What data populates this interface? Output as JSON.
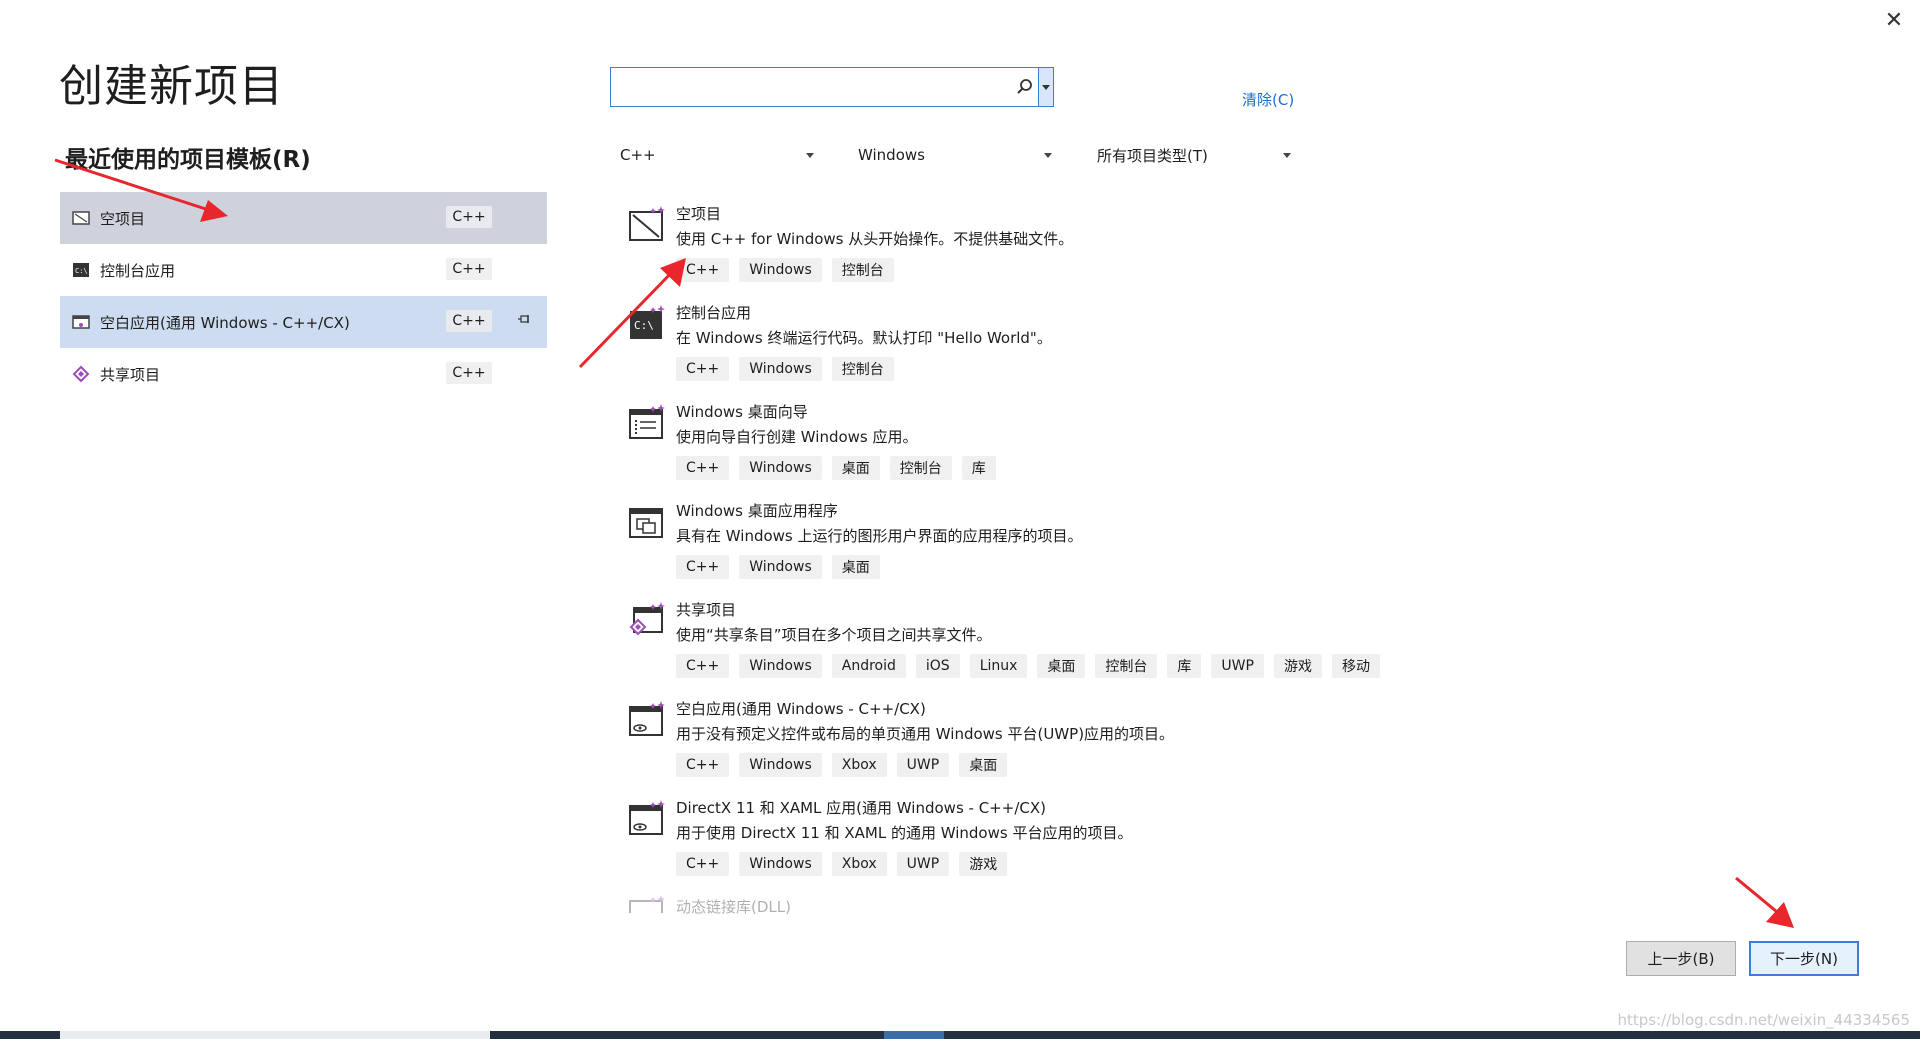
{
  "window": {
    "close_glyph": "✕"
  },
  "title": "创建新项目",
  "recent": {
    "heading": "最近使用的项目模板(R)",
    "items": [
      {
        "label": "空项目",
        "tag": "C++",
        "icon": "empty-project-icon"
      },
      {
        "label": "控制台应用",
        "tag": "C++",
        "icon": "console-app-icon"
      },
      {
        "label": "空白应用(通用 Windows - C++/CX)",
        "tag": "C++",
        "icon": "blank-app-icon",
        "pinned": true
      },
      {
        "label": "共享项目",
        "tag": "C++",
        "icon": "shared-project-icon"
      }
    ]
  },
  "search": {
    "value": "",
    "placeholder": ""
  },
  "clear_label": "清除(C)",
  "filters": {
    "language": "C++",
    "platform": "Windows",
    "project_type": "所有项目类型(T)"
  },
  "templates": [
    {
      "name": "空项目",
      "desc": "使用 C++ for Windows 从头开始操作。不提供基础文件。",
      "tags": [
        "C++",
        "Windows",
        "控制台"
      ]
    },
    {
      "name": "控制台应用",
      "desc": "在 Windows 终端运行代码。默认打印 \"Hello World\"。",
      "tags": [
        "C++",
        "Windows",
        "控制台"
      ]
    },
    {
      "name": "Windows 桌面向导",
      "desc": "使用向导自行创建 Windows 应用。",
      "tags": [
        "C++",
        "Windows",
        "桌面",
        "控制台",
        "库"
      ]
    },
    {
      "name": "Windows 桌面应用程序",
      "desc": "具有在 Windows 上运行的图形用户界面的应用程序的项目。",
      "tags": [
        "C++",
        "Windows",
        "桌面"
      ]
    },
    {
      "name": "共享项目",
      "desc": "使用“共享条目”项目在多个项目之间共享文件。",
      "tags": [
        "C++",
        "Windows",
        "Android",
        "iOS",
        "Linux",
        "桌面",
        "控制台",
        "库",
        "UWP",
        "游戏",
        "移动"
      ]
    },
    {
      "name": "空白应用(通用 Windows - C++/CX)",
      "desc": "用于没有预定义控件或布局的单页通用 Windows 平台(UWP)应用的项目。",
      "tags": [
        "C++",
        "Windows",
        "Xbox",
        "UWP",
        "桌面"
      ]
    },
    {
      "name": "DirectX 11 和 XAML 应用(通用 Windows - C++/CX)",
      "desc": "用于使用 DirectX 11 和 XAML 的通用 Windows 平台应用的项目。",
      "tags": [
        "C++",
        "Windows",
        "Xbox",
        "UWP",
        "游戏"
      ]
    },
    {
      "name": "动态链接库(DLL)",
      "desc": "",
      "tags": []
    }
  ],
  "buttons": {
    "back": "上一步(B)",
    "next": "下一步(N)"
  },
  "watermark": "https://blog.csdn.net/weixin_44334565",
  "colors": {
    "accent": "#3b7dd8",
    "link": "#1a6fcf",
    "arrow": "#e8262b",
    "selected_gray": "#cfd2dc",
    "selected_blue": "#cddcf0"
  }
}
